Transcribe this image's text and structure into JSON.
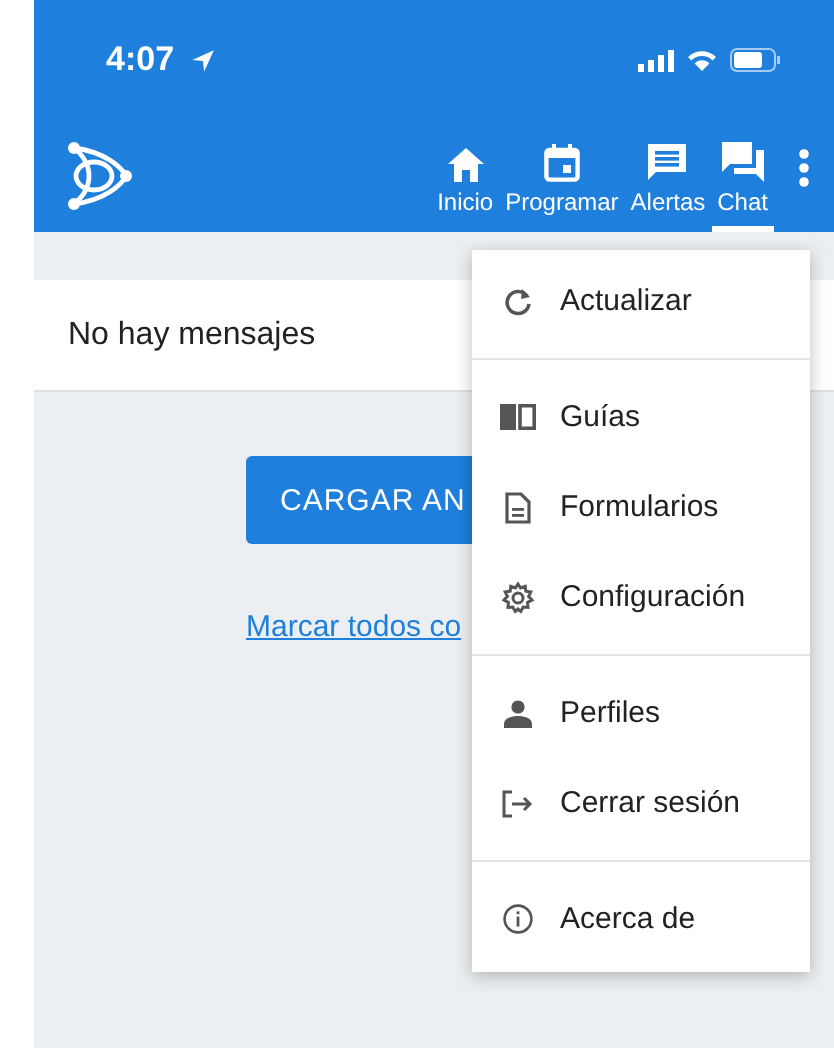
{
  "status_bar": {
    "time": "4:07"
  },
  "tabs": [
    {
      "label": "Inicio",
      "selected": false
    },
    {
      "label": "Programar",
      "selected": false
    },
    {
      "label": "Alertas",
      "selected": false
    },
    {
      "label": "Chat",
      "selected": true
    }
  ],
  "message": "No hay mensajes",
  "load_button": "CARGAR AN",
  "mark_link": "Marcar todos co",
  "menu": {
    "groups": [
      [
        {
          "label": "Actualizar"
        }
      ],
      [
        {
          "label": "Guías"
        },
        {
          "label": "Formularios"
        },
        {
          "label": "Configuración"
        }
      ],
      [
        {
          "label": "Perfiles"
        },
        {
          "label": "Cerrar sesión"
        }
      ],
      [
        {
          "label": "Acerca de"
        }
      ]
    ]
  }
}
